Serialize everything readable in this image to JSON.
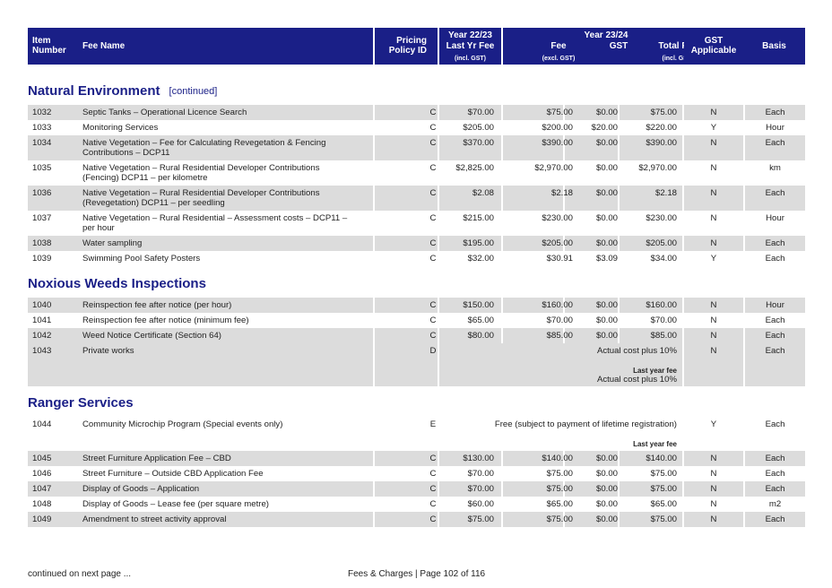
{
  "header": {
    "item_number": [
      "Item",
      "Number"
    ],
    "fee_name": "Fee Name",
    "pricing_policy": [
      "Pricing",
      "Policy ID"
    ],
    "year_prev": "Year 22/23",
    "last_yr_fee": "Last Yr Fee",
    "incl_gst": "(incl. GST)",
    "year_curr": "Year 23/24",
    "fee": "Fee",
    "excl_gst": "(excl. GST)",
    "gst": "GST",
    "total_fee": "Total Fee",
    "total_incl_gst": "(incl. GST)",
    "gst_applicable": [
      "GST",
      "Applicable"
    ],
    "basis": "Basis"
  },
  "sections": {
    "natural": {
      "title": "Natural Environment",
      "continued": "[continued]",
      "rows": [
        {
          "item": "1032",
          "name": "Septic Tanks – Operational Licence Search",
          "policy": "C",
          "last": "$70.00",
          "fee": "$75.00",
          "gst": "$0.00",
          "total": "$75.00",
          "gst_app": "N",
          "basis": "Each"
        },
        {
          "item": "1033",
          "name": "Monitoring Services",
          "policy": "C",
          "last": "$205.00",
          "fee": "$200.00",
          "gst": "$20.00",
          "total": "$220.00",
          "gst_app": "Y",
          "basis": "Hour"
        },
        {
          "item": "1034",
          "name": "Native Vegetation – Fee for Calculating Revegetation & Fencing Contributions – DCP11",
          "policy": "C",
          "last": "$370.00",
          "fee": "$390.00",
          "gst": "$0.00",
          "total": "$390.00",
          "gst_app": "N",
          "basis": "Each"
        },
        {
          "item": "1035",
          "name": "Native Vegetation – Rural Residential Developer Contributions (Fencing) DCP11 – per kilometre",
          "policy": "C",
          "last": "$2,825.00",
          "fee": "$2,970.00",
          "gst": "$0.00",
          "total": "$2,970.00",
          "gst_app": "N",
          "basis": "km"
        },
        {
          "item": "1036",
          "name": "Native Vegetation – Rural Residential Developer Contributions (Revegetation) DCP11 – per seedling",
          "policy": "C",
          "last": "$2.08",
          "fee": "$2.18",
          "gst": "$0.00",
          "total": "$2.18",
          "gst_app": "N",
          "basis": "Each"
        },
        {
          "item": "1037",
          "name": "Native Vegetation – Rural Residential – Assessment costs – DCP11 – per hour",
          "policy": "C",
          "last": "$215.00",
          "fee": "$230.00",
          "gst": "$0.00",
          "total": "$230.00",
          "gst_app": "N",
          "basis": "Hour"
        },
        {
          "item": "1038",
          "name": "Water sampling",
          "policy": "C",
          "last": "$195.00",
          "fee": "$205.00",
          "gst": "$0.00",
          "total": "$205.00",
          "gst_app": "N",
          "basis": "Each"
        },
        {
          "item": "1039",
          "name": "Swimming Pool Safety Posters",
          "policy": "C",
          "last": "$32.00",
          "fee": "$30.91",
          "gst": "$3.09",
          "total": "$34.00",
          "gst_app": "Y",
          "basis": "Each"
        }
      ]
    },
    "weeds": {
      "title": "Noxious Weeds Inspections",
      "rows": [
        {
          "item": "1040",
          "name": "Reinspection fee after notice (per hour)",
          "policy": "C",
          "last": "$150.00",
          "fee": "$160.00",
          "gst": "$0.00",
          "total": "$160.00",
          "gst_app": "N",
          "basis": "Hour"
        },
        {
          "item": "1041",
          "name": "Reinspection fee after notice (minimum fee)",
          "policy": "C",
          "last": "$65.00",
          "fee": "$70.00",
          "gst": "$0.00",
          "total": "$70.00",
          "gst_app": "N",
          "basis": "Each"
        },
        {
          "item": "1042",
          "name": "Weed Notice Certificate (Section 64)",
          "policy": "C",
          "last": "$80.00",
          "fee": "$85.00",
          "gst": "$0.00",
          "total": "$85.00",
          "gst_app": "N",
          "basis": "Each"
        }
      ],
      "private": {
        "item": "1043",
        "name": "Private works",
        "policy": "D",
        "fee_text": "Actual cost plus 10%",
        "last_label": "Last year fee",
        "last_text": "Actual cost plus 10%",
        "gst_app": "N",
        "basis": "Each"
      }
    },
    "ranger": {
      "title": "Ranger Services",
      "microchip": {
        "item": "1044",
        "name": "Community Microchip Program (Special events only)",
        "policy": "E",
        "fee_text": "Free (subject to payment of lifetime registration)",
        "last_label": "Last year fee",
        "gst_app": "Y",
        "basis": "Each"
      },
      "rows": [
        {
          "item": "1045",
          "name": "Street Furniture Application Fee – CBD",
          "policy": "C",
          "last": "$130.00",
          "fee": "$140.00",
          "gst": "$0.00",
          "total": "$140.00",
          "gst_app": "N",
          "basis": "Each"
        },
        {
          "item": "1046",
          "name": "Street Furniture – Outside CBD Application Fee",
          "policy": "C",
          "last": "$70.00",
          "fee": "$75.00",
          "gst": "$0.00",
          "total": "$75.00",
          "gst_app": "N",
          "basis": "Each"
        },
        {
          "item": "1047",
          "name": "Display of Goods – Application",
          "policy": "C",
          "last": "$70.00",
          "fee": "$75.00",
          "gst": "$0.00",
          "total": "$75.00",
          "gst_app": "N",
          "basis": "Each"
        },
        {
          "item": "1048",
          "name": "Display of Goods – Lease fee (per square metre)",
          "policy": "C",
          "last": "$60.00",
          "fee": "$65.00",
          "gst": "$0.00",
          "total": "$65.00",
          "gst_app": "N",
          "basis": "m2"
        },
        {
          "item": "1049",
          "name": "Amendment to street activity approval",
          "policy": "C",
          "last": "$75.00",
          "fee": "$75.00",
          "gst": "$0.00",
          "total": "$75.00",
          "gst_app": "N",
          "basis": "Each"
        }
      ]
    }
  },
  "footer": {
    "continued": "continued on next page ...",
    "page": "Fees & Charges | Page 102 of 116"
  }
}
